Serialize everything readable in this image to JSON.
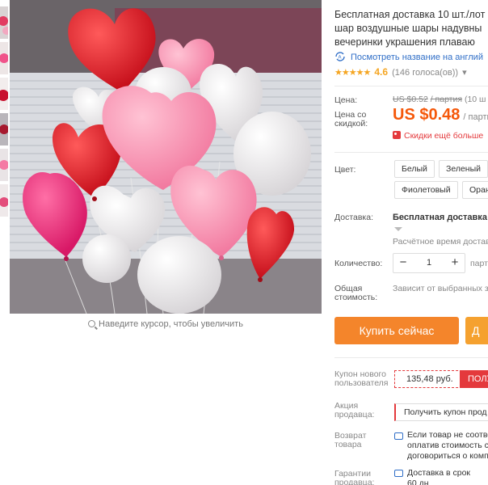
{
  "product": {
    "title_lines": [
      "Бесплатная доставка 10 шт./лот",
      "шар воздушные шары надувны",
      "вечеринки украшения плаваю"
    ],
    "translate_link": "Посмотреть название на англий",
    "rating": {
      "stars": "★★★★★",
      "value": "4.6",
      "votes": "(146 голоса(ов))",
      "chevron": "▾"
    },
    "zoom_hint": "Наведите курсор, чтобы увеличить"
  },
  "price": {
    "label": "Цена:",
    "old_value": "US $0.52",
    "old_unit": "/ партия",
    "old_extra": "(10 ш",
    "discount_label_1": "Цена со",
    "discount_label_2": "скидкой:",
    "new_value": "US $0.48",
    "new_unit": "/ парти",
    "more_discounts": "Скидки ещё больше"
  },
  "color": {
    "label": "Цвет:",
    "options": [
      "Белый",
      "Зеленый",
      "Фиолетовый",
      "Оран"
    ]
  },
  "delivery": {
    "label": "Доставка:",
    "main": "Бесплатная доставка в",
    "estimate": "Расчётное время доставк"
  },
  "quantity": {
    "label": "Количество:",
    "minus": "−",
    "value": "1",
    "plus": "+",
    "note": "парти"
  },
  "total": {
    "label_1": "Общая",
    "label_2": "стоимость:",
    "value": "Зависит от выбранных з"
  },
  "buttons": {
    "buy_now": "Купить сейчас",
    "second": "Д"
  },
  "coupon": {
    "label_1": "Купон нового",
    "label_2": "пользователя",
    "amount": "135,48 руб.",
    "get": "ПОЛУ"
  },
  "seller_promo": {
    "label_1": "Акция",
    "label_2": "продавца:",
    "text": "Получить купон прод"
  },
  "returns": {
    "label_1": "Возврат",
    "label_2": "товара",
    "line1": "Если товар не соотве",
    "line2": "оплатив стоимость с",
    "line3": "договориться о комп"
  },
  "guarantee": {
    "label_1": "Гарантии",
    "label_2": "продавца:",
    "line1": "Доставка в срок",
    "line2": "60 дн"
  },
  "colors": {
    "accent_orange": "#f5580a",
    "buy_button": "#f4852b",
    "red": "#e4393c",
    "link_blue": "#2f6ec7",
    "star": "#f5a623"
  }
}
